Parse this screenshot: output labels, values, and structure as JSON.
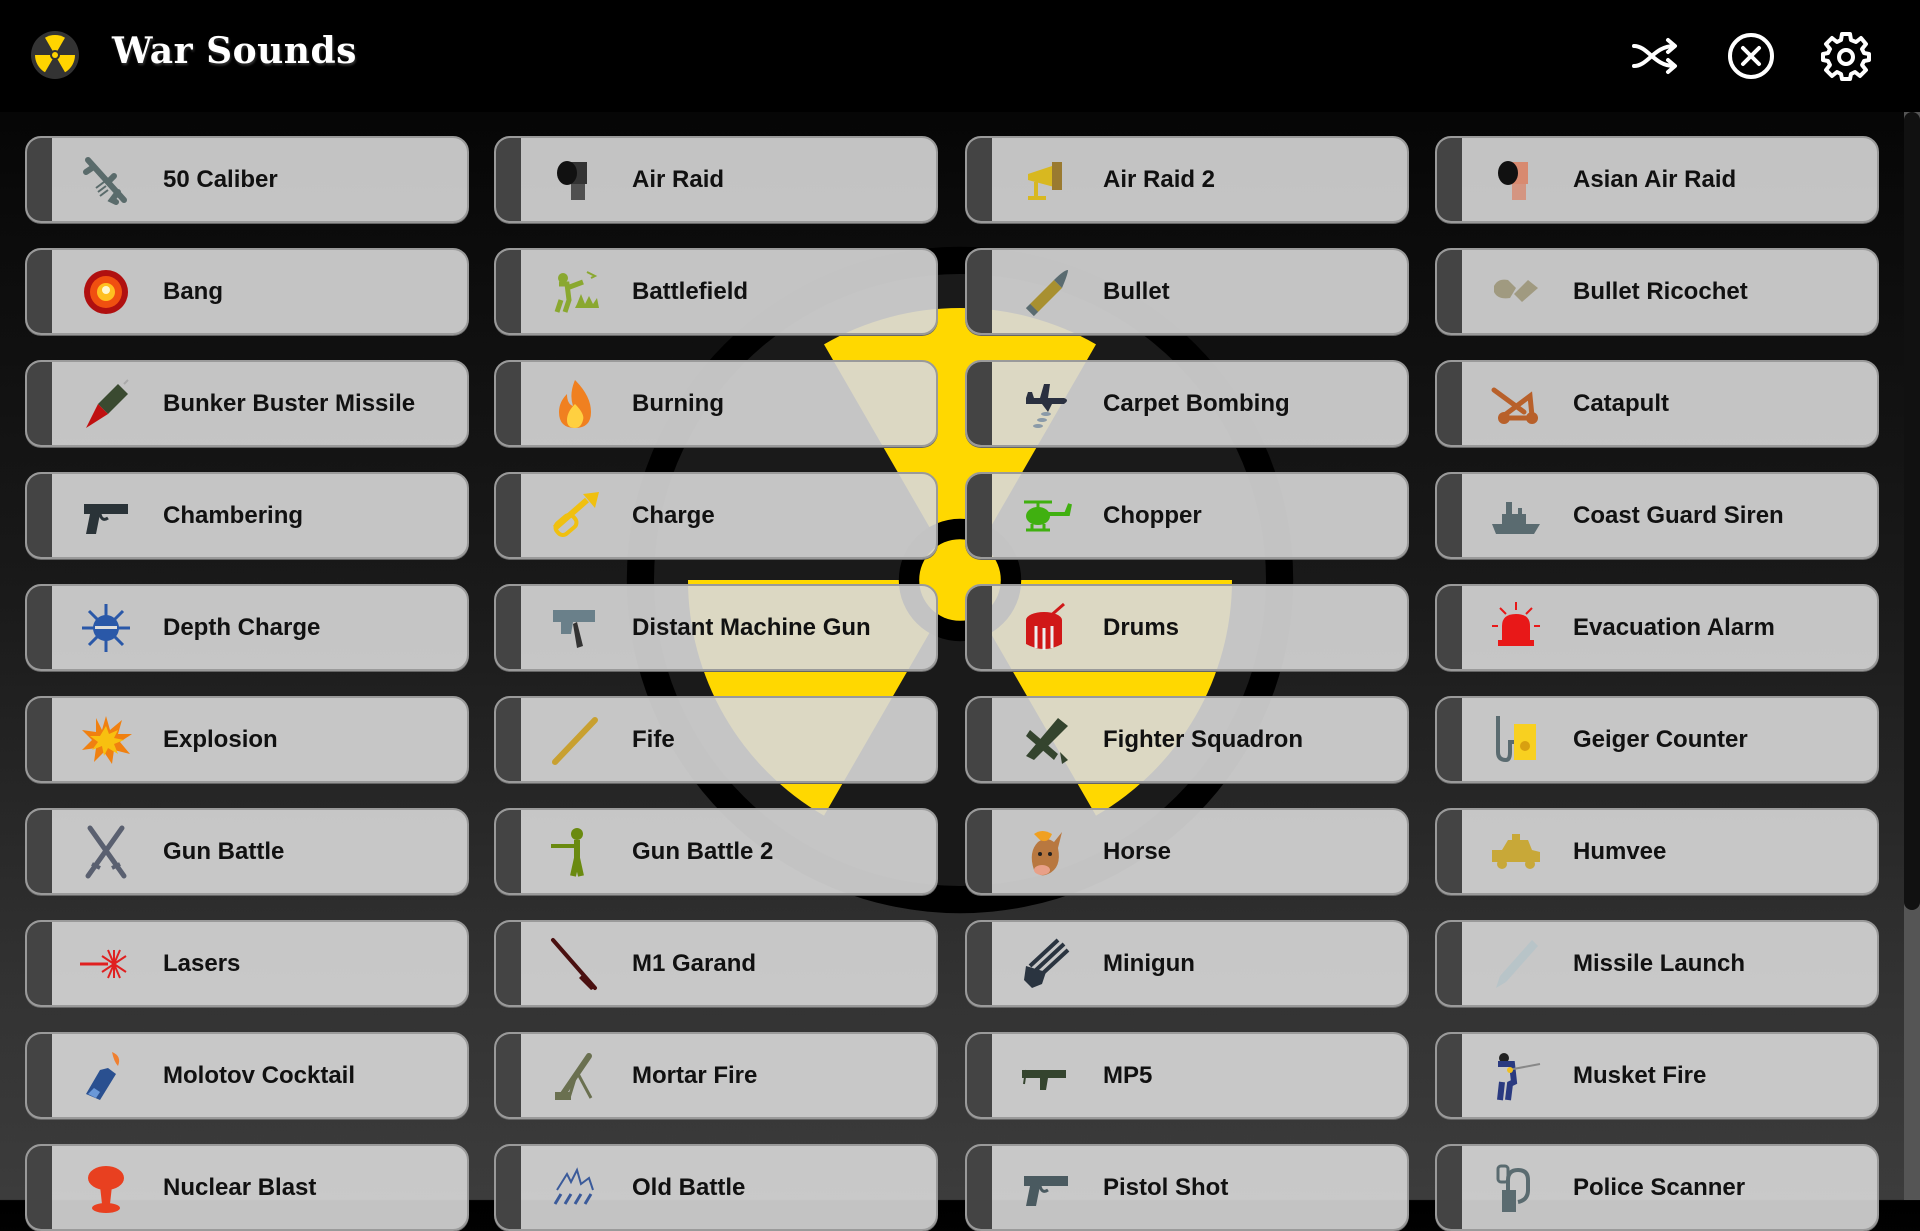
{
  "header": {
    "title": "War Sounds",
    "logo_icon": "radiation-icon",
    "buttons": [
      {
        "name": "shuffle-button",
        "icon": "shuffle-icon"
      },
      {
        "name": "stop-button",
        "icon": "close-circle-icon"
      },
      {
        "name": "settings-button",
        "icon": "gear-icon"
      }
    ]
  },
  "colors": {
    "header_bg": "#000000",
    "card_bg": "#d8d8d8",
    "card_strip": "#444444",
    "accent_yellow": "#ffd400",
    "text": "#111111"
  },
  "sounds": [
    {
      "label": "50 Caliber",
      "icon": "machine-gun-icon",
      "color": "#5a6b6b"
    },
    {
      "label": "Air Raid",
      "icon": "siren-horn-icon",
      "color": "#333333"
    },
    {
      "label": "Air Raid 2",
      "icon": "megaphone-icon",
      "color": "#d8b820"
    },
    {
      "label": "Asian Air Raid",
      "icon": "siren-horn-icon",
      "color": "#d88a70"
    },
    {
      "label": "Bang",
      "icon": "blast-icon",
      "color": "#e02010"
    },
    {
      "label": "Battlefield",
      "icon": "soldiers-icon",
      "color": "#8aa830"
    },
    {
      "label": "Bullet",
      "icon": "bullet-icon",
      "color": "#a89030"
    },
    {
      "label": "Bullet Ricochet",
      "icon": "ricochet-icon",
      "color": "#a09a80"
    },
    {
      "label": "Bunker Buster Missile",
      "icon": "missile-icon",
      "color": "#3a4a30"
    },
    {
      "label": "Burning",
      "icon": "fire-icon",
      "color": "#f08020"
    },
    {
      "label": "Carpet Bombing",
      "icon": "bomber-plane-icon",
      "color": "#2a3040"
    },
    {
      "label": "Catapult",
      "icon": "catapult-icon",
      "color": "#b8602a"
    },
    {
      "label": "Chambering",
      "icon": "pistol-icon",
      "color": "#2a3338"
    },
    {
      "label": "Charge",
      "icon": "trumpet-icon",
      "color": "#f0c010"
    },
    {
      "label": "Chopper",
      "icon": "helicopter-icon",
      "color": "#40b010"
    },
    {
      "label": "Coast Guard Siren",
      "icon": "ship-icon",
      "color": "#5a6b70"
    },
    {
      "label": "Depth Charge",
      "icon": "sea-mine-icon",
      "color": "#2a58a8"
    },
    {
      "label": "Distant Machine Gun",
      "icon": "smg-icon",
      "color": "#6a808a"
    },
    {
      "label": "Drums",
      "icon": "drum-icon",
      "color": "#d01818"
    },
    {
      "label": "Evacuation Alarm",
      "icon": "alarm-light-icon",
      "color": "#e81818"
    },
    {
      "label": "Explosion",
      "icon": "explosion-icon",
      "color": "#f8c010"
    },
    {
      "label": "Fife",
      "icon": "flute-icon",
      "color": "#c8a030"
    },
    {
      "label": "Fighter Squadron",
      "icon": "fighter-plane-icon",
      "color": "#34442e"
    },
    {
      "label": "Geiger Counter",
      "icon": "geiger-counter-icon",
      "color": "#f8d020"
    },
    {
      "label": "Gun Battle",
      "icon": "crossed-rifles-icon",
      "color": "#5a6070"
    },
    {
      "label": "Gun Battle 2",
      "icon": "soldier-icon",
      "color": "#6a8a10"
    },
    {
      "label": "Horse",
      "icon": "horse-icon",
      "color": "#b87840"
    },
    {
      "label": "Humvee",
      "icon": "humvee-icon",
      "color": "#c8a838"
    },
    {
      "label": "Lasers",
      "icon": "laser-icon",
      "color": "#e02020"
    },
    {
      "label": "M1 Garand",
      "icon": "rifle-icon",
      "color": "#4a1010"
    },
    {
      "label": "Minigun",
      "icon": "minigun-icon",
      "color": "#2a3440"
    },
    {
      "label": "Missile Launch",
      "icon": "rocket-icon",
      "color": "#b8c4c8"
    },
    {
      "label": "Molotov Cocktail",
      "icon": "molotov-icon",
      "color": "#2a5090"
    },
    {
      "label": "Mortar Fire",
      "icon": "mortar-icon",
      "color": "#6a7050"
    },
    {
      "label": "MP5",
      "icon": "mp5-icon",
      "color": "#34442e"
    },
    {
      "label": "Musket Fire",
      "icon": "musketeer-icon",
      "color": "#2a3a80"
    },
    {
      "label": "Nuclear Blast",
      "icon": "mushroom-cloud-icon",
      "color": "#e84020"
    },
    {
      "label": "Old Battle",
      "icon": "cavalry-icon",
      "color": "#3a5a9a"
    },
    {
      "label": "Pistol Shot",
      "icon": "pistol-icon",
      "color": "#4a5a60"
    },
    {
      "label": "Police Scanner",
      "icon": "radio-scanner-icon",
      "color": "#5a6b70"
    }
  ]
}
